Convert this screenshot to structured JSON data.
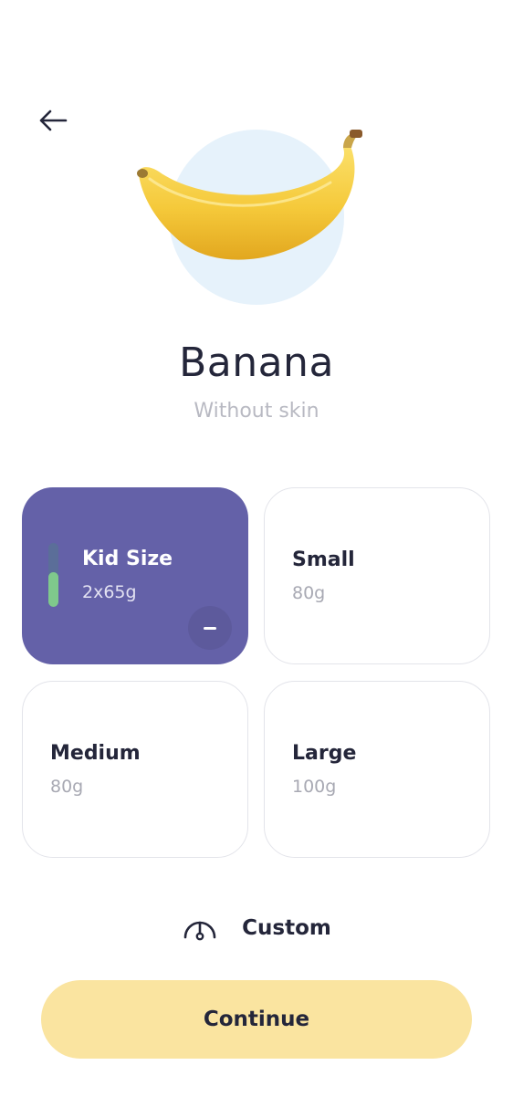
{
  "header": {
    "back_icon": "arrow-left-icon"
  },
  "food": {
    "name": "Banana",
    "description": "Without skin",
    "image_icon": "banana-image"
  },
  "portions": [
    {
      "label": "Kid Size",
      "amount": "2x65g",
      "selected": true,
      "level_fraction": 0.55
    },
    {
      "label": "Small",
      "amount": "80g",
      "selected": false
    },
    {
      "label": "Medium",
      "amount": "80g",
      "selected": false
    },
    {
      "label": "Large",
      "amount": "100g",
      "selected": false
    }
  ],
  "custom": {
    "label": "Custom",
    "icon": "gauge-icon"
  },
  "continue_button": {
    "label": "Continue"
  },
  "colors": {
    "selected_card": "#6461a8",
    "level_fill": "#7fc98c",
    "continue_bg": "#fae4a0",
    "hero_circle": "#e6f2fb"
  }
}
